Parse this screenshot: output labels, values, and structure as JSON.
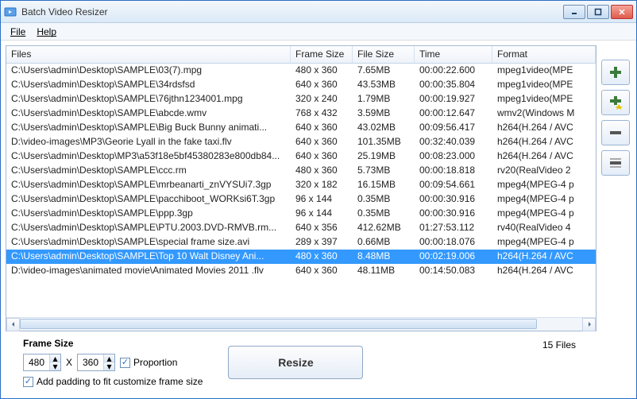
{
  "window": {
    "title": "Batch Video Resizer"
  },
  "menu": {
    "file": "File",
    "help": "Help"
  },
  "table": {
    "headers": {
      "files": "Files",
      "frame": "Frame Size",
      "size": "File Size",
      "time": "Time",
      "format": "Format"
    },
    "rows": [
      {
        "path": "C:\\Users\\admin\\Desktop\\SAMPLE\\03(7).mpg",
        "frame": "480 x 360",
        "size": "7.65MB",
        "time": "00:00:22.600",
        "format": "mpeg1video(MPE",
        "selected": false
      },
      {
        "path": "C:\\Users\\admin\\Desktop\\SAMPLE\\34rdsfsd",
        "frame": "640 x 360",
        "size": "43.53MB",
        "time": "00:00:35.804",
        "format": "mpeg1video(MPE",
        "selected": false
      },
      {
        "path": "C:\\Users\\admin\\Desktop\\SAMPLE\\76jthn1234001.mpg",
        "frame": "320 x 240",
        "size": "1.79MB",
        "time": "00:00:19.927",
        "format": "mpeg1video(MPE",
        "selected": false
      },
      {
        "path": "C:\\Users\\admin\\Desktop\\SAMPLE\\abcde.wmv",
        "frame": "768 x 432",
        "size": "3.59MB",
        "time": "00:00:12.647",
        "format": "wmv2(Windows M",
        "selected": false
      },
      {
        "path": "C:\\Users\\admin\\Desktop\\SAMPLE\\Big Buck Bunny animati...",
        "frame": "640 x 360",
        "size": "43.02MB",
        "time": "00:09:56.417",
        "format": "h264(H.264 / AVC",
        "selected": false
      },
      {
        "path": "D:\\video-images\\MP3\\Georie Lyall in the fake taxi.flv",
        "frame": "640 x 360",
        "size": "101.35MB",
        "time": "00:32:40.039",
        "format": "h264(H.264 / AVC",
        "selected": false
      },
      {
        "path": "C:\\Users\\admin\\Desktop\\MP3\\a53f18e5bf45380283e800db84...",
        "frame": "640 x 360",
        "size": "25.19MB",
        "time": "00:08:23.000",
        "format": "h264(H.264 / AVC",
        "selected": false
      },
      {
        "path": "C:\\Users\\admin\\Desktop\\SAMPLE\\ccc.rm",
        "frame": "480 x 360",
        "size": "5.73MB",
        "time": "00:00:18.818",
        "format": "rv20(RealVideo 2",
        "selected": false
      },
      {
        "path": "C:\\Users\\admin\\Desktop\\SAMPLE\\mrbeanarti_znVYSUi7.3gp",
        "frame": "320 x 182",
        "size": "16.15MB",
        "time": "00:09:54.661",
        "format": "mpeg4(MPEG-4 p",
        "selected": false
      },
      {
        "path": "C:\\Users\\admin\\Desktop\\SAMPLE\\pacchiboot_WORKsi6T.3gp",
        "frame": "96 x 144",
        "size": "0.35MB",
        "time": "00:00:30.916",
        "format": "mpeg4(MPEG-4 p",
        "selected": false
      },
      {
        "path": "C:\\Users\\admin\\Desktop\\SAMPLE\\ppp.3gp",
        "frame": "96 x 144",
        "size": "0.35MB",
        "time": "00:00:30.916",
        "format": "mpeg4(MPEG-4 p",
        "selected": false
      },
      {
        "path": "C:\\Users\\admin\\Desktop\\SAMPLE\\PTU.2003.DVD-RMVB.rm...",
        "frame": "640 x 356",
        "size": "412.62MB",
        "time": "01:27:53.112",
        "format": "rv40(RealVideo 4",
        "selected": false
      },
      {
        "path": "C:\\Users\\admin\\Desktop\\SAMPLE\\special frame size.avi",
        "frame": "289 x 397",
        "size": "0.66MB",
        "time": "00:00:18.076",
        "format": "mpeg4(MPEG-4 p",
        "selected": false
      },
      {
        "path": "C:\\Users\\admin\\Desktop\\SAMPLE\\Top 10 Walt Disney Ani...",
        "frame": "480 x 360",
        "size": "8.48MB",
        "time": "00:02:19.006",
        "format": "h264(H.264 / AVC",
        "selected": true
      },
      {
        "path": "D:\\video-images\\animated movie\\Animated Movies 2011 .flv",
        "frame": "640 x 360",
        "size": "48.11MB",
        "time": "00:14:50.083",
        "format": "h264(H.264 / AVC",
        "selected": false
      }
    ]
  },
  "controls": {
    "frame_size_label": "Frame Size",
    "width": "480",
    "height": "360",
    "x_sep": "X",
    "proportion_label": "Proportion",
    "proportion_checked": true,
    "padding_label": "Add padding to fit customize frame size",
    "padding_checked": true,
    "resize_label": "Resize",
    "file_count": "15 Files"
  },
  "side": {
    "add": "add-file",
    "add_star": "add-folder",
    "remove": "remove",
    "clear": "clear-all"
  }
}
